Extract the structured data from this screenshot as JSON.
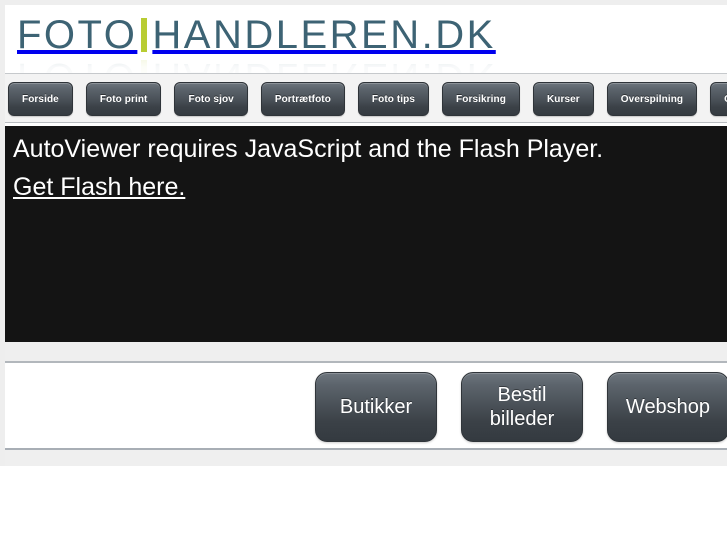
{
  "site": {
    "logo": {
      "part1": "FOTO",
      "divider": "logo-divider-bar",
      "part2": "HANDLEREN.DK",
      "text_color": "#3d6374",
      "divider_color": "#b8cc33"
    }
  },
  "nav": {
    "items": [
      {
        "label": "Forside"
      },
      {
        "label": "Foto print"
      },
      {
        "label": "Foto sjov"
      },
      {
        "label": "Portrætfoto"
      },
      {
        "label": "Foto tips"
      },
      {
        "label": "Forsikring"
      },
      {
        "label": "Kurser"
      },
      {
        "label": "Overspilning"
      },
      {
        "label": "Om os"
      }
    ]
  },
  "viewer": {
    "background_color": "#141414",
    "message": "AutoViewer requires JavaScript and the Flash Player.",
    "link_label": "Get Flash here."
  },
  "actions": {
    "buttons": [
      {
        "label": "Butikker"
      },
      {
        "label": "Bestil\nbilleder"
      },
      {
        "label": "Webshop"
      }
    ]
  }
}
